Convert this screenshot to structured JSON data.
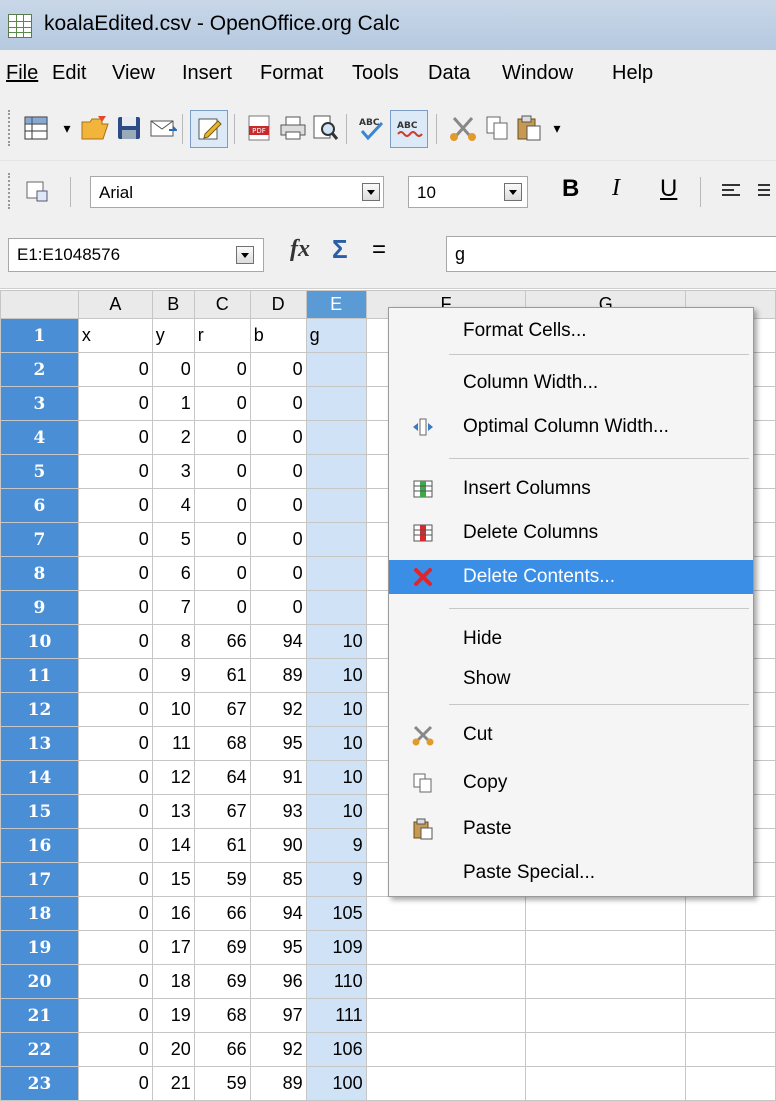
{
  "window": {
    "title": "koalaEdited.csv - OpenOffice.org Calc"
  },
  "menubar": {
    "items": [
      "File",
      "Edit",
      "View",
      "Insert",
      "Format",
      "Tools",
      "Data",
      "Window",
      "Help"
    ]
  },
  "toolbar": {
    "font_name": "Arial",
    "font_size": "10",
    "bold": "B",
    "italic": "I",
    "underline": "U"
  },
  "formula_bar": {
    "name_box": "E1:E1048576",
    "function_wizard": "fx",
    "sum": "Σ",
    "equals": "=",
    "input_value": "g"
  },
  "sheet": {
    "columns": [
      "A",
      "B",
      "C",
      "D",
      "E",
      "F",
      "G"
    ],
    "selected_column": "E",
    "rows": [
      {
        "n": "1",
        "A": "x",
        "B": "y",
        "C": "r",
        "D": "b",
        "E": "g"
      },
      {
        "n": "2",
        "A": "0",
        "B": "0",
        "C": "0",
        "D": "0",
        "E": ""
      },
      {
        "n": "3",
        "A": "0",
        "B": "1",
        "C": "0",
        "D": "0",
        "E": ""
      },
      {
        "n": "4",
        "A": "0",
        "B": "2",
        "C": "0",
        "D": "0",
        "E": ""
      },
      {
        "n": "5",
        "A": "0",
        "B": "3",
        "C": "0",
        "D": "0",
        "E": ""
      },
      {
        "n": "6",
        "A": "0",
        "B": "4",
        "C": "0",
        "D": "0",
        "E": ""
      },
      {
        "n": "7",
        "A": "0",
        "B": "5",
        "C": "0",
        "D": "0",
        "E": ""
      },
      {
        "n": "8",
        "A": "0",
        "B": "6",
        "C": "0",
        "D": "0",
        "E": ""
      },
      {
        "n": "9",
        "A": "0",
        "B": "7",
        "C": "0",
        "D": "0",
        "E": ""
      },
      {
        "n": "10",
        "A": "0",
        "B": "8",
        "C": "66",
        "D": "94",
        "E": "10"
      },
      {
        "n": "11",
        "A": "0",
        "B": "9",
        "C": "61",
        "D": "89",
        "E": "10"
      },
      {
        "n": "12",
        "A": "0",
        "B": "10",
        "C": "67",
        "D": "92",
        "E": "10"
      },
      {
        "n": "13",
        "A": "0",
        "B": "11",
        "C": "68",
        "D": "95",
        "E": "10"
      },
      {
        "n": "14",
        "A": "0",
        "B": "12",
        "C": "64",
        "D": "91",
        "E": "10"
      },
      {
        "n": "15",
        "A": "0",
        "B": "13",
        "C": "67",
        "D": "93",
        "E": "10"
      },
      {
        "n": "16",
        "A": "0",
        "B": "14",
        "C": "61",
        "D": "90",
        "E": "9"
      },
      {
        "n": "17",
        "A": "0",
        "B": "15",
        "C": "59",
        "D": "85",
        "E": "9"
      },
      {
        "n": "18",
        "A": "0",
        "B": "16",
        "C": "66",
        "D": "94",
        "E": "105"
      },
      {
        "n": "19",
        "A": "0",
        "B": "17",
        "C": "69",
        "D": "95",
        "E": "109"
      },
      {
        "n": "20",
        "A": "0",
        "B": "18",
        "C": "69",
        "D": "96",
        "E": "110"
      },
      {
        "n": "21",
        "A": "0",
        "B": "19",
        "C": "68",
        "D": "97",
        "E": "111"
      },
      {
        "n": "22",
        "A": "0",
        "B": "20",
        "C": "66",
        "D": "92",
        "E": "106"
      },
      {
        "n": "23",
        "A": "0",
        "B": "21",
        "C": "59",
        "D": "89",
        "E": "100"
      }
    ]
  },
  "context_menu": {
    "items": [
      {
        "id": "format-cells",
        "label": "Format Cells...",
        "icon": "none"
      },
      {
        "id": "column-width",
        "label": "Column Width...",
        "icon": "none"
      },
      {
        "id": "optimal-column-width",
        "label": "Optimal Column Width...",
        "icon": "optimal-width-icon"
      },
      {
        "id": "insert-columns",
        "label": "Insert Columns",
        "icon": "insert-columns-icon"
      },
      {
        "id": "delete-columns",
        "label": "Delete Columns",
        "icon": "delete-columns-icon"
      },
      {
        "id": "delete-contents",
        "label": "Delete Contents...",
        "icon": "delete-contents-icon",
        "highlighted": true
      },
      {
        "id": "hide",
        "label": "Hide",
        "icon": "none"
      },
      {
        "id": "show",
        "label": "Show",
        "icon": "none"
      },
      {
        "id": "cut",
        "label": "Cut",
        "icon": "cut-icon"
      },
      {
        "id": "copy",
        "label": "Copy",
        "icon": "copy-icon"
      },
      {
        "id": "paste",
        "label": "Paste",
        "icon": "paste-icon"
      },
      {
        "id": "paste-special",
        "label": "Paste Special...",
        "icon": "none"
      }
    ]
  },
  "colors": {
    "selection_blue": "#4a8fd6",
    "menu_highlight": "#3a8ee6",
    "selected_column_fill": "#cfe2f6"
  }
}
